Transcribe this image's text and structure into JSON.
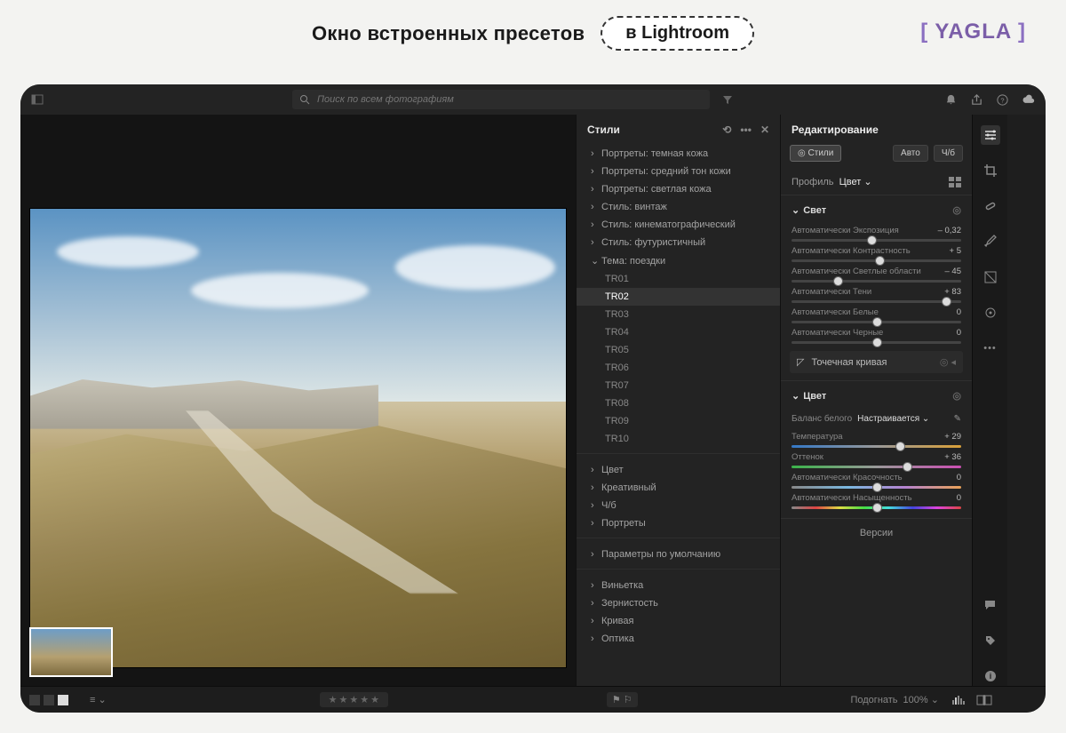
{
  "page_header": {
    "title": "Окно встроенных пресетов",
    "pill": "в Lightroom",
    "brand": "YAGLA"
  },
  "topbar": {
    "search_placeholder": "Поиск по всем фотографиям"
  },
  "presets": {
    "title": "Стили",
    "groups_top": [
      "Портреты: темная кожа",
      "Портреты: средний тон кожи",
      "Портреты: светлая кожа",
      "Стиль: винтаж",
      "Стиль: кинематографический",
      "Стиль: футуристичный"
    ],
    "open_group": "Тема: поездки",
    "open_items": [
      "TR01",
      "TR02",
      "TR03",
      "TR04",
      "TR05",
      "TR06",
      "TR07",
      "TR08",
      "TR09",
      "TR10"
    ],
    "selected_item": "TR02",
    "groups_mid": [
      "Цвет",
      "Креативный",
      "Ч/б",
      "Портреты"
    ],
    "group_defaults": "Параметры по умолчанию",
    "groups_bot": [
      "Виньетка",
      "Зернистость",
      "Кривая",
      "Оптика"
    ]
  },
  "edit": {
    "title": "Редактирование",
    "style_chip": "Стили",
    "auto_chip": "Авто",
    "bw_chip": "Ч/б",
    "profile_label": "Профиль",
    "profile_value": "Цвет",
    "light": {
      "title": "Свет",
      "exposure": {
        "label": "Автоматически Экспозиция",
        "value": "– 0,32",
        "pos": 47
      },
      "contrast": {
        "label": "Автоматически Контрастность",
        "value": "+ 5",
        "pos": 52
      },
      "highlights": {
        "label": "Автоматически Светлые области",
        "value": "– 45",
        "pos": 27
      },
      "shadows": {
        "label": "Автоматически Тени",
        "value": "+ 83",
        "pos": 91
      },
      "whites": {
        "label": "Автоматически Белые",
        "value": "0",
        "pos": 50
      },
      "blacks": {
        "label": "Автоматически Черные",
        "value": "0",
        "pos": 50
      },
      "curve": "Точечная кривая"
    },
    "color": {
      "title": "Цвет",
      "wb_label": "Баланс белого",
      "wb_value": "Настраивается",
      "temp": {
        "label": "Температура",
        "value": "+ 29",
        "pos": 64
      },
      "tint": {
        "label": "Оттенок",
        "value": "+ 36",
        "pos": 68
      },
      "vibrance": {
        "label": "Автоматически Красочность",
        "value": "0",
        "pos": 50
      },
      "saturation": {
        "label": "Автоматически Насыщенность",
        "value": "0",
        "pos": 50
      }
    },
    "versions": "Версии"
  },
  "bottombar": {
    "fit": "Подогнать",
    "zoom": "100%"
  }
}
